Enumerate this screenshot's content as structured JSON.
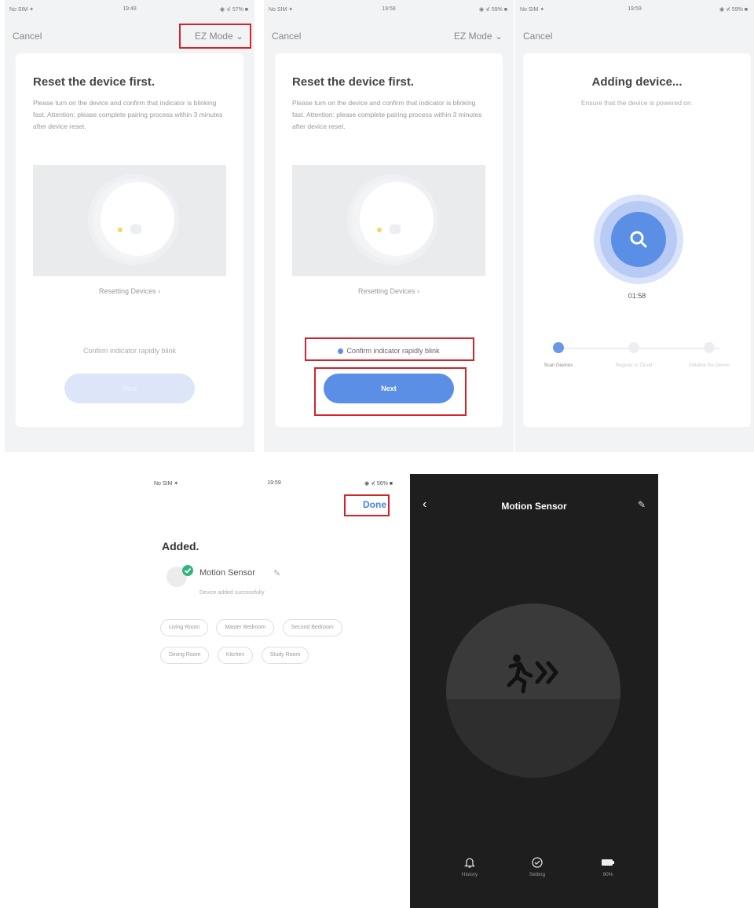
{
  "screen1": {
    "status": {
      "carrier": "No SIM ✦",
      "time": "19:48",
      "battery": "◉ ⊀ 57% ■"
    },
    "cancel_label": "Cancel",
    "mode_label": "EZ Mode",
    "title": "Reset the device first.",
    "description": "Please turn on the device and confirm that indicator is blinking fast. Attention: please complete pairing process within 3 minutes after device reset.",
    "resetting_label": "Resetting Devices",
    "confirm_label": "Confirm indicator rapidly blink",
    "next_label": "Next"
  },
  "screen2": {
    "status": {
      "carrier": "No SIM ✦",
      "time": "19:58",
      "battery": "◉ ⊀ 59% ■"
    },
    "cancel_label": "Cancel",
    "mode_label": "EZ Mode",
    "title": "Reset the device first.",
    "description": "Please turn on the device and confirm that indicator is blinking fast. Attention: please complete pairing process within 3 minutes after device reset.",
    "resetting_label": "Resetting Devices",
    "confirm_label": "Confirm indicator rapidly blink",
    "next_label": "Next"
  },
  "screen3": {
    "status": {
      "carrier": "No SIM ✦",
      "time": "19:59",
      "battery": "◉ ⊀ 59% ■"
    },
    "cancel_label": "Cancel",
    "title": "Adding device...",
    "subtitle": "Ensure that the device is powered on.",
    "timer": "01:58",
    "steps": [
      "Scan Devices",
      "Register to Cloud",
      "Initialize the Device"
    ]
  },
  "screen4": {
    "status": {
      "carrier": "No SIM ✦",
      "time": "19:59",
      "battery": "◉ ⊀ 56% ■"
    },
    "done_label": "Done",
    "added_label": "Added.",
    "device_name": "Motion Sensor",
    "device_status": "Device added successfully",
    "rooms": [
      "Living Room",
      "Master Bedroom",
      "Second Bedroom",
      "Dining Room",
      "Kitchen",
      "Study Room"
    ]
  },
  "screen5": {
    "title": "Motion Sensor",
    "tabs": {
      "history": "History",
      "setting": "Setting",
      "battery": "90%"
    }
  },
  "colors": {
    "accent": "#5b8fe6",
    "highlight": "#d2232a",
    "success": "#34b37e",
    "dark_bg": "#1e1e1e"
  }
}
